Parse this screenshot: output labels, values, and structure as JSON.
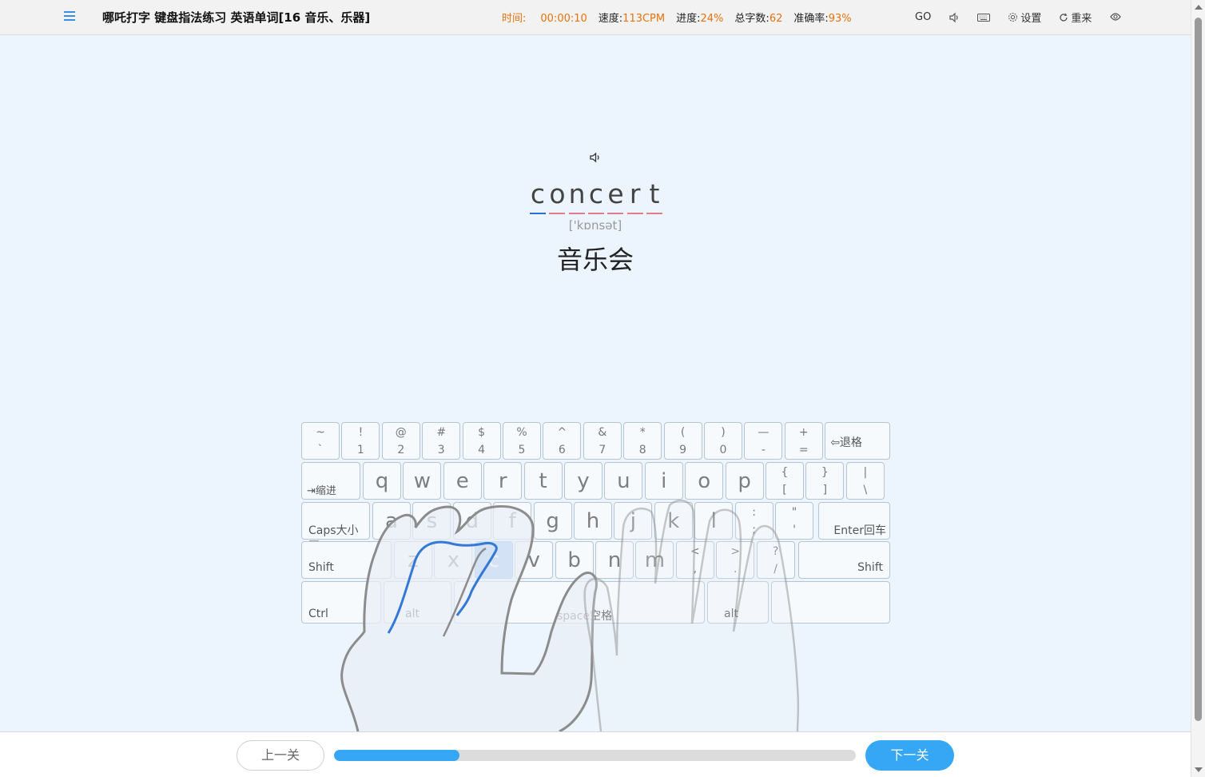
{
  "header": {
    "title": "哪吒打字 键盘指法练习 英语单词[16 音乐、乐器]",
    "stats": [
      {
        "label": "时间:",
        "value": "00:00:10"
      },
      {
        "label": "速度:",
        "value": "113CPM"
      },
      {
        "label": "进度:",
        "value": "24%"
      },
      {
        "label": "总字数:",
        "value": "62"
      },
      {
        "label": "准确率:",
        "value": "93%"
      }
    ],
    "tools": {
      "go": "GO",
      "settings": "设置",
      "restart": "重来"
    },
    "icons": [
      "menu-icon",
      "speaker-icon",
      "keyboard-icon",
      "gear-icon",
      "refresh-icon",
      "skin-icon"
    ]
  },
  "word": {
    "letters": [
      "c",
      "o",
      "n",
      "c",
      "e",
      "r",
      "t"
    ],
    "active_index": 0,
    "phonetic": "['kɒnsət]",
    "meaning": "音乐会"
  },
  "keyboard": {
    "row1": [
      {
        "top": "~",
        "bottom": "`"
      },
      {
        "top": "!",
        "bottom": "1"
      },
      {
        "top": "@",
        "bottom": "2"
      },
      {
        "top": "#",
        "bottom": "3"
      },
      {
        "top": "$",
        "bottom": "4"
      },
      {
        "top": "%",
        "bottom": "5"
      },
      {
        "top": "^",
        "bottom": "6"
      },
      {
        "top": "&",
        "bottom": "7"
      },
      {
        "top": "*",
        "bottom": "8"
      },
      {
        "top": "(",
        "bottom": "9"
      },
      {
        "top": ")",
        "bottom": "0"
      },
      {
        "top": "—",
        "bottom": "-"
      },
      {
        "top": "+",
        "bottom": "="
      }
    ],
    "backspace": "⇦退格",
    "tab": "⇥缩进",
    "row2": [
      "q",
      "w",
      "e",
      "r",
      "t",
      "y",
      "u",
      "i",
      "o",
      "p"
    ],
    "row2_sym": [
      {
        "top": "{",
        "bottom": "["
      },
      {
        "top": "}",
        "bottom": "]"
      },
      {
        "top": "|",
        "bottom": "\\"
      }
    ],
    "caps": "Caps大小写",
    "row3": [
      "a",
      "s",
      "d",
      "f",
      "g",
      "h",
      "j",
      "k",
      "l"
    ],
    "row3_sym": [
      {
        "top": ":",
        "bottom": ";"
      },
      {
        "top": "\"",
        "bottom": "'"
      }
    ],
    "enter": "Enter回车",
    "shift_left": "Shift",
    "row4": [
      "z",
      "x",
      "c",
      "v",
      "b",
      "n",
      "m"
    ],
    "row4_sym": [
      {
        "top": "<",
        "bottom": ","
      },
      {
        "top": ">",
        "bottom": "."
      },
      {
        "top": "?",
        "bottom": "/"
      }
    ],
    "shift_right": "Shift",
    "ctrl": "Ctrl",
    "alt_left": "alt",
    "space": "space空格",
    "alt_right": "alt",
    "highlight_key": "c"
  },
  "footer": {
    "prev_label": "上一关",
    "next_label": "下一关",
    "progress_fraction": 0.24
  },
  "colors": {
    "accent": "#35a7f5",
    "stat_value": "#e8720c",
    "highlight_key": "#8ec3f2",
    "active_underline": "#2c6fd1",
    "pending_underline": "#e07e88"
  }
}
